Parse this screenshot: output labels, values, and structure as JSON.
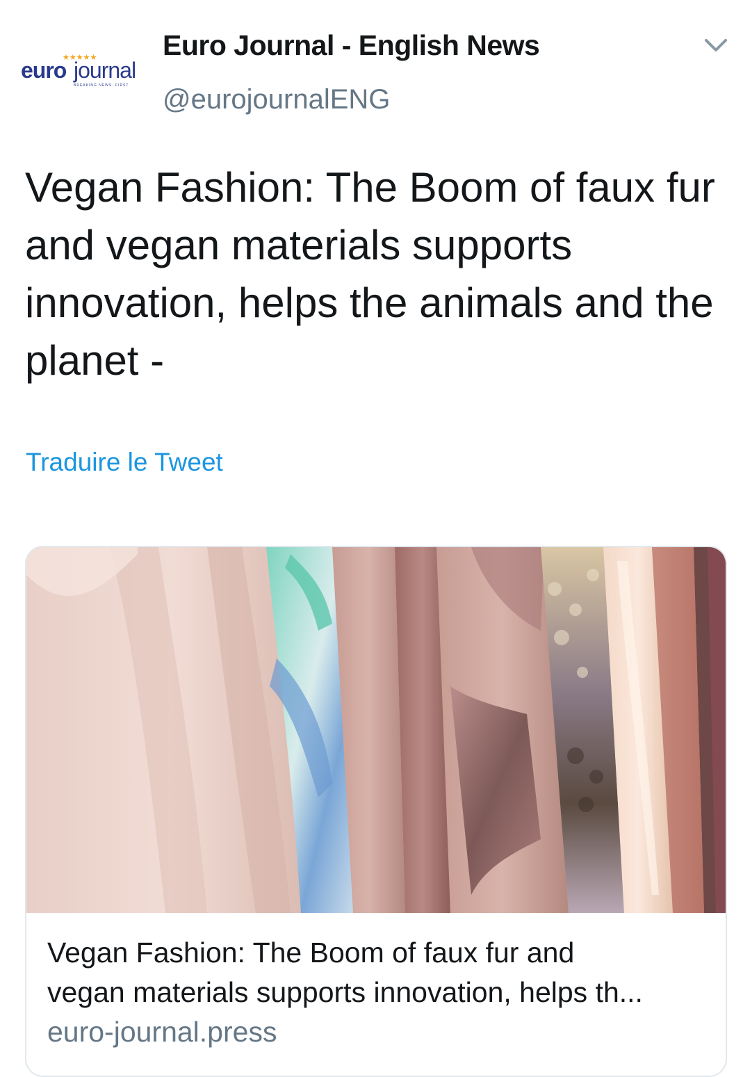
{
  "account": {
    "name": "Euro Journal - English News",
    "handle": "@eurojournalENG",
    "avatar_logo": {
      "brand_left": "euro",
      "brand_right": "journal",
      "tagline": "BREAKING NEWS. FIRST"
    }
  },
  "tweet": {
    "text": "Vegan Fashion: The Boom of faux fur and vegan materials supports innovation, helps the animals and the planet -",
    "translate_label": "Traduire le Tweet"
  },
  "card": {
    "title_line1": "Vegan Fashion: The Boom of faux fur and",
    "title_line2": "vegan materials supports innovation, helps th...",
    "domain": "euro-journal.press",
    "image_subject": "rack of faux fur fabric swatches in pink, teal, mauve and beige tones"
  },
  "icons": {
    "menu": "chevron-down-icon"
  },
  "colors": {
    "text": "#14171a",
    "secondary_text": "#657786",
    "link": "#1b95e0",
    "border": "#e1e8ed",
    "logo_blue": "#2a3a8c",
    "logo_gold": "#f2a51d"
  }
}
